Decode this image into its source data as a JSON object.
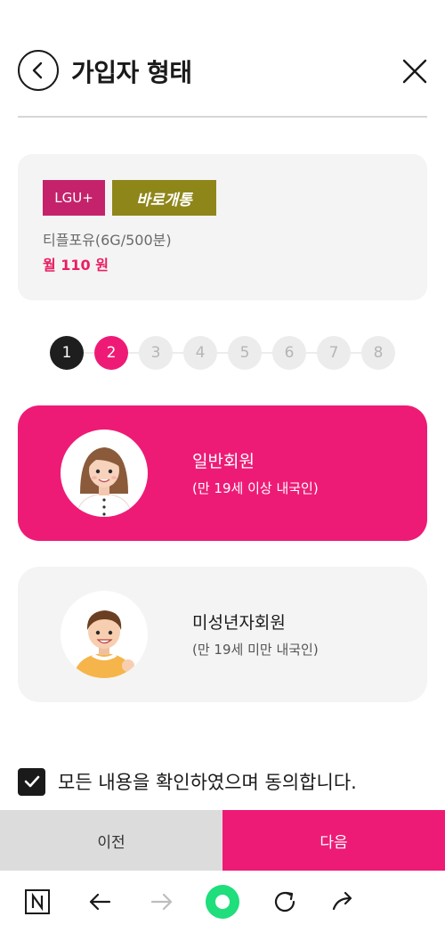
{
  "header": {
    "title": "가입자 형태"
  },
  "plan": {
    "carrier": "LGU+",
    "open_type": "바로개통",
    "name": "티플포유(6G/500분)",
    "price": "월 110 원"
  },
  "stepper": {
    "current": 2,
    "total": 8,
    "steps": [
      "1",
      "2",
      "3",
      "4",
      "5",
      "6",
      "7",
      "8"
    ]
  },
  "member_types": [
    {
      "title": "일반회원",
      "subtitle": "(만 19세 이상 내국인)",
      "selected": true
    },
    {
      "title": "미성년자회원",
      "subtitle": "(만 19세 미만 내국인)",
      "selected": false
    }
  ],
  "agreement": {
    "label": "모든 내용을 확인하였으며 동의합니다.",
    "checked": true
  },
  "buttons": {
    "prev": "이전",
    "next": "다음"
  },
  "colors": {
    "accent": "#ee1b76",
    "carrier_badge": "#c4236b",
    "open_badge": "#8f861a",
    "card_bg": "#f4f4f4"
  },
  "browser_bar": {
    "icons": [
      "naver-n-icon",
      "back-arrow-icon",
      "forward-arrow-icon",
      "home-circle-icon",
      "refresh-icon",
      "share-icon"
    ]
  }
}
